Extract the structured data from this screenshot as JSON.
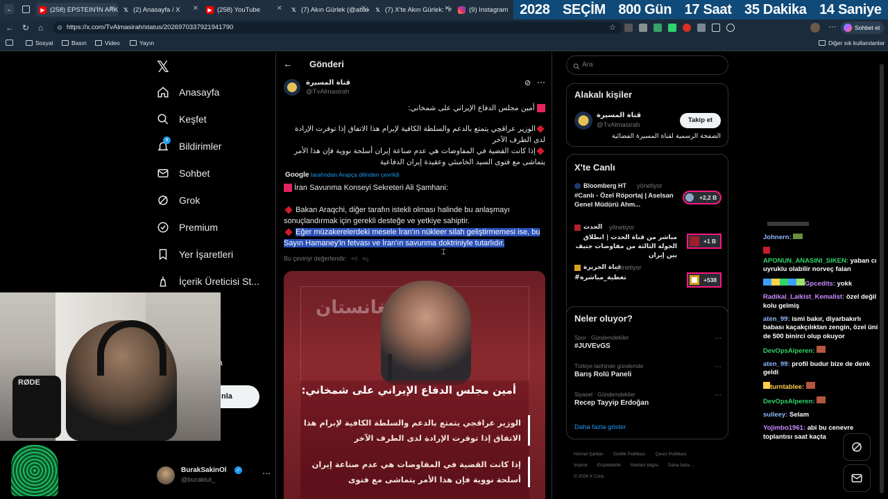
{
  "browser": {
    "tabs": [
      {
        "label": "(258) EPSTEIN'İN ARKA",
        "favicon": "youtube-icon"
      },
      {
        "label": "(2) Anasayfa / X",
        "favicon": "x-logo-icon"
      },
      {
        "label": "(258) YouTube",
        "favicon": "youtube-icon"
      },
      {
        "label": "(7) Akın Gürlek (@abak",
        "favicon": "x-logo-icon"
      },
      {
        "label": "(7) X'te Akın Gürlek: \"#",
        "favicon": "x-logo-icon"
      },
      {
        "label": "(9) Instagram",
        "favicon": "instagram-icon"
      }
    ],
    "countdown": [
      "2028",
      "SEÇİM",
      "800 Gün",
      "17 Saat",
      "35 Dakika",
      "14 Saniye"
    ],
    "url": "https://x.com/TvAlmasirah/status/2026970337921941790",
    "sohbet_label": "Sohbet et",
    "bookmarks": [
      "Sosyal",
      "Basın",
      "Video",
      "Yayın"
    ],
    "other_bookmarks": "Diğer sık kullanılanlar"
  },
  "nav": {
    "items": [
      "Anasayfa",
      "Keşfet",
      "Bildirimler",
      "Sohbet",
      "Grok",
      "Premium",
      "Yer İşaretleri",
      "İçerik Üreticisi St..."
    ],
    "notif_badge": "9",
    "post_button": "nla",
    "profile_name": "BurakSakinOl",
    "profile_handle": "@buraktut_",
    "partial_char": "a"
  },
  "post": {
    "header": "Gönderi",
    "author_name": "قناة المسيرة",
    "author_handle": "@TvAlmasirah",
    "arabic_lines": [
      "أمين مجلس الدفاع الإيراني على شمخاني:",
      "الوزير عراقچي يتمتع بالدعم والسلطة الكافية لإبرام هذا الاتفاق إذا توفرت الإرادة لدى الطرف الآخر",
      "إذا كانت القضية في المفاوضات هي عدم صناعة إيران أسلحة نووية فإن هذا الأمر يتماشى مع فتوى السيد الخامنئي وعقيدة إيران الدفاعية"
    ],
    "translated_by_brand": "Google",
    "translated_by": "tarafından Arapça dilinden çevrildi",
    "translation": [
      "İran Savunma Konseyi Sekreteri Ali Şamhani:",
      "Bakan Araqchi, diğer tarafın istekli olması halinde bu anlaşmayı sonuçlandırmak için gerekli desteğe ve yetkiye sahiptir.",
      "Eğer müzakerelerdeki mesele İran'ın nükleer silah geliştirmemesi ise, bu Sayın Hamaney'in fetvası ve İran'ın savunma doktriniyle tutarlıdır."
    ],
    "rate": "Bu çeviriyi değerlendir:",
    "image_header_text": "على شمخاني",
    "image_bg_text": "ملى افغانستان",
    "image_lines": [
      "أمين مجلس الدفاع الإيراني على شمخاني:",
      "الوزير عراقجي يتمتع بالدعم والسلطة الكافية لإبرام هذا الاتفاق إذا توفرت الإرادة لدى الطرف الآخر",
      "إذا كانت القضية في المفاوضات هي عدم صناعة إيران أسلحة نووية فإن هذا الأمر يتماشى مع فتوى"
    ]
  },
  "search_placeholder": "Ara",
  "related": {
    "title": "Alakalı kişiler",
    "name": "قناة المسيرة",
    "handle": "@TvAlmasirah",
    "follow": "Takip et",
    "bio": "الصفحة الرسمية لقناة المسيرة الفضائية"
  },
  "live": {
    "title": "X'te Canlı",
    "items": [
      {
        "source": "Bloomberg HT",
        "role": "yönetiyor",
        "text": "#Canlı - Özel Röportaj | Aselsan Genel Müdürü Ahm...",
        "count": "+2,2 B"
      },
      {
        "source": "الحدث",
        "role": "yönetiyor",
        "text": "مباشر من قناة الحدث | انطلاق الجولة الثالثة من مفاوضات جنيف بين إيران",
        "count": "+1 B"
      },
      {
        "source": "قناة الجزيرة",
        "role": "yönetiyor",
        "text": "#تغطية_مباشرة",
        "count": "+538"
      }
    ]
  },
  "trends": {
    "title": "Neler oluyor?",
    "items": [
      {
        "context": "Spor · Gündemdekiler",
        "name": "#JUVEvGS"
      },
      {
        "context": "Türkiye tarihinde gündemde",
        "name": "Barış Rolü Paneli"
      },
      {
        "context": "Siyaset · Gündemdekiler",
        "name": "Recep Tayyip Erdoğan"
      }
    ],
    "more": "Daha fazla göster"
  },
  "footer": {
    "links": [
      "Hizmet Şartları",
      "Gizlilik Politikası",
      "Çerez Politikası",
      "Imprint",
      "Erişilebilirlik",
      "Reklam bilgisi",
      "Daha fazla ..."
    ],
    "copyright": "© 2026 X Corp."
  },
  "chat": [
    {
      "user": "Johnern:",
      "msg": "",
      "color": "#8fb7ff"
    },
    {
      "user": "APONUN_ANASINI_SIKEN:",
      "msg": "yaban cı uyruklu olabilir norveç falan",
      "color": "#31d36b"
    },
    {
      "user": "Gpcedits:",
      "msg": "yokk",
      "color": "#c88cff"
    },
    {
      "user": "Radikal_Laikist_Kemalist:",
      "msg": "özel değil kolu gelmiş",
      "color": "#c88cff"
    },
    {
      "user": "aten_99:",
      "msg": "ismi bakır, diyarbakırlı babası kaçakçılıktan zengin, özel üni de 500 binirci olup okuyor",
      "color": "#8fb7ff"
    },
    {
      "user": "DevOpsAlperen:",
      "msg": "",
      "color": "#31d36b"
    },
    {
      "user": "aten_99:",
      "msg": "profil budur bize de denk geldi",
      "color": "#8fb7ff"
    },
    {
      "user": "turntablee:",
      "msg": "",
      "color": "#ffd24a"
    },
    {
      "user": "DevOpsAlperen:",
      "msg": "",
      "color": "#31d36b"
    },
    {
      "user": "sulleey:",
      "msg": "Selam",
      "color": "#8fb7ff"
    },
    {
      "user": "Yojimbo1961:",
      "msg": "abi bu cenevre toplantısı saat kaçta",
      "color": "#c88cff"
    }
  ],
  "webcam_brand": "RØDE",
  "colors": {
    "accent": "#1d9bf0",
    "highlight": "#2b51b8",
    "countdown_bg": "#0f4a79"
  }
}
